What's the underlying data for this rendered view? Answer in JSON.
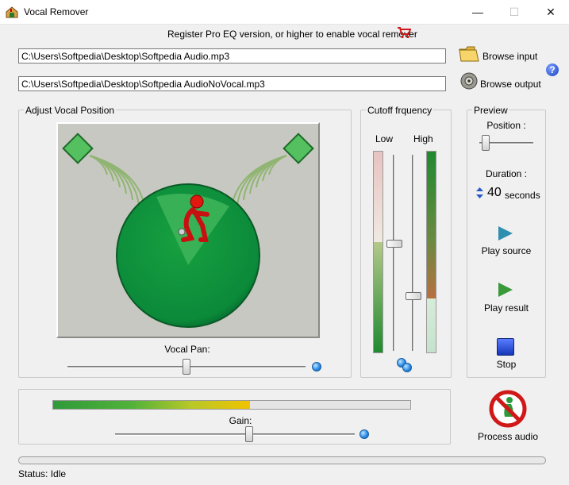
{
  "window": {
    "title": "Vocal Remover",
    "minimize_glyph": "—",
    "maximize_glyph": "☐",
    "close_glyph": "✕"
  },
  "register_text": "Register Pro EQ version, or higher to enable vocal remover",
  "input_path": "C:\\Users\\Softpedia\\Desktop\\Softpedia Audio.mp3",
  "output_path": "C:\\Users\\Softpedia\\Desktop\\Softpedia AudioNoVocal.mp3",
  "browse_input_label": "Browse input",
  "browse_output_label": "Browse output",
  "help_glyph": "?",
  "vocal_group": {
    "title": "Adjust Vocal Position",
    "pan_label": "Vocal Pan:",
    "pan_value": 0.5
  },
  "cutoff_group": {
    "title": "Cutoff frquency",
    "low_label": "Low",
    "high_label": "High",
    "low_value": 0.55,
    "high_value": 0.27
  },
  "preview_group": {
    "title": "Preview",
    "position_label": "Position :",
    "position_value": 0.05,
    "duration_label": "Duration :",
    "duration_value": "40",
    "duration_unit": "seconds",
    "play_source_label": "Play source",
    "play_result_label": "Play result",
    "stop_label": "Stop"
  },
  "gain": {
    "label": "Gain:",
    "level": 0.55,
    "value": 0.56
  },
  "process_label": "Process audio",
  "progress_value": 0,
  "status_text": "Status: Idle",
  "icons": {
    "app": "app-icon",
    "cart": "cart-icon",
    "browse_input": "folder-icon",
    "browse_output": "speaker-icon",
    "help": "help-icon",
    "process": "no-vocal-icon"
  },
  "colors": {
    "green": "#0b8a3a",
    "light_green": "#22a34a",
    "gain_yellow": "#f2c200",
    "stop_blue": "#1636b8",
    "play_teal": "#2e8fb0"
  }
}
